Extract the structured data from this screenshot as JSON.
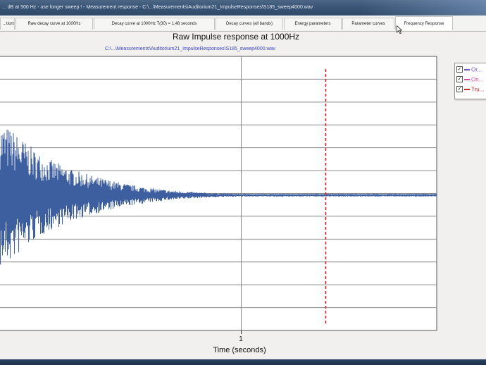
{
  "window": {
    "title": "... dB at 500 Hz - use longer sweep ! - Measurement response - C:\\...\\Measurements\\Auditorium21_ImpulseResponses\\S185_sweep4000.wav"
  },
  "tabs": [
    {
      "label": "...tions",
      "active": false
    },
    {
      "label": "Raw decay curve at 1000Hz",
      "active": false
    },
    {
      "label": "Decay curve at 1000Hz T(30) = 1,48 seconds",
      "active": false
    },
    {
      "label": "Decay curves (all bands)",
      "active": false
    },
    {
      "label": "Energy parameters",
      "active": false
    },
    {
      "label": "Parameter curves",
      "active": false
    },
    {
      "label": "Frequency Response",
      "active": true
    }
  ],
  "chart": {
    "title": "Raw Impulse response at 1000Hz",
    "subtitle": "C:\\...\\Measurements\\Auditorium21_ImpulseResponses\\S185_sweep4000.wav",
    "xlabel": "Time (seconds)"
  },
  "legend": {
    "items": [
      {
        "label": "Or...",
        "color": "#6a4fc8",
        "checked": true
      },
      {
        "label": "On...",
        "color": "#d946a8",
        "checked": true
      },
      {
        "label": "Tru...",
        "color": "#d42020",
        "checked": true
      }
    ]
  },
  "colors": {
    "waveform": "#3d5fa0",
    "marker": "#d42020",
    "grid": "#8a8a8a",
    "plot_bg": "#ffffff",
    "subtitle": "#3b46c4"
  },
  "chart_data": {
    "type": "line",
    "title": "Raw Impulse response at 1000Hz",
    "xlabel": "Time (seconds)",
    "ylabel": "",
    "x_ticks": [
      "1"
    ],
    "x_range": [
      0,
      1.81
    ],
    "y_range": [
      -1,
      1
    ],
    "grid": true,
    "legend_position": "right",
    "marker_x": 1.35,
    "series": [
      {
        "name": "Raw impulse response (envelope)",
        "points": [
          [
            0.0,
            0.8
          ],
          [
            0.05,
            0.72
          ],
          [
            0.1,
            0.6
          ],
          [
            0.15,
            0.48
          ],
          [
            0.2,
            0.4
          ],
          [
            0.25,
            0.34
          ],
          [
            0.3,
            0.28
          ],
          [
            0.35,
            0.24
          ],
          [
            0.4,
            0.2
          ],
          [
            0.45,
            0.17
          ],
          [
            0.5,
            0.14
          ],
          [
            0.55,
            0.11
          ],
          [
            0.6,
            0.09
          ],
          [
            0.65,
            0.07
          ],
          [
            0.7,
            0.055
          ],
          [
            0.75,
            0.045
          ],
          [
            0.8,
            0.035
          ],
          [
            0.85,
            0.028
          ],
          [
            0.9,
            0.022
          ],
          [
            0.95,
            0.018
          ],
          [
            1.0,
            0.015
          ],
          [
            1.1,
            0.012
          ],
          [
            1.2,
            0.01
          ],
          [
            1.35,
            0.009
          ],
          [
            1.5,
            0.008
          ],
          [
            1.81,
            0.008
          ]
        ]
      }
    ]
  }
}
